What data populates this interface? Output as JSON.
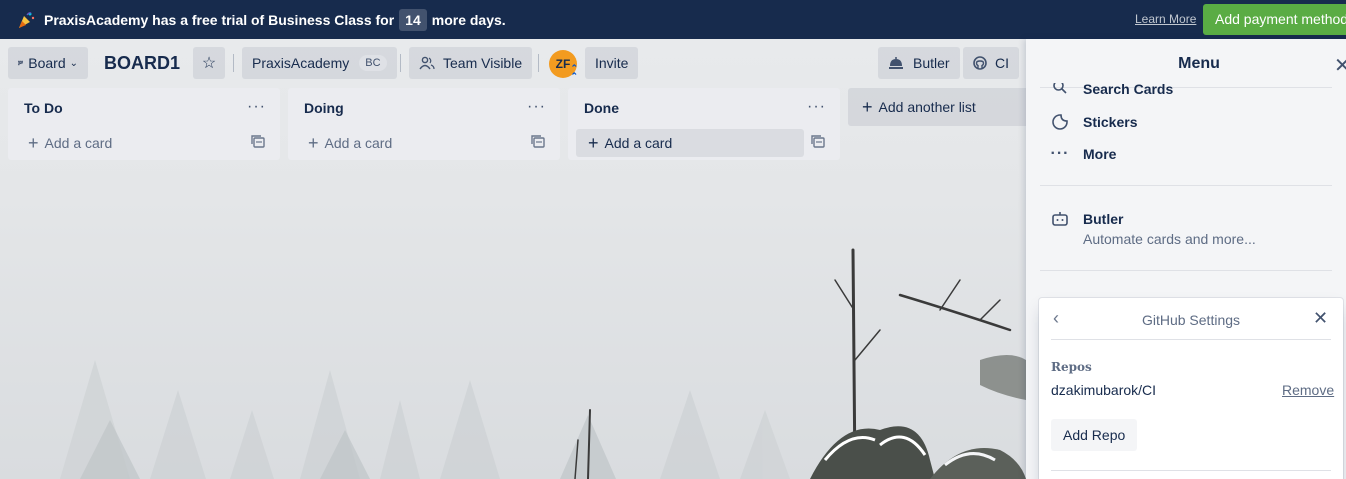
{
  "banner": {
    "message_pre": "PraxisAcademy has a free trial of Business Class for",
    "days": "14",
    "message_post": "more days.",
    "learn_more": "Learn More",
    "add_payment": "Add payment method"
  },
  "header": {
    "board_switch": "Board",
    "board_title": "BOARD1",
    "team_name": "PraxisAcademy",
    "team_badge": "BC",
    "visibility": "Team Visible",
    "avatar_initials": "ZF",
    "invite": "Invite",
    "butler": "Butler",
    "ci": "CI"
  },
  "lists": [
    {
      "name": "To Do",
      "add_label": "Add a card"
    },
    {
      "name": "Doing",
      "add_label": "Add a card"
    },
    {
      "name": "Done",
      "add_label": "Add a card"
    }
  ],
  "add_list_label": "Add another list",
  "menu": {
    "title": "Menu",
    "items": [
      {
        "label": "Search Cards",
        "icon": "search-icon"
      },
      {
        "label": "Stickers",
        "icon": "sticker-icon"
      },
      {
        "label": "More",
        "icon": "more-icon"
      }
    ],
    "butler": {
      "label": "Butler",
      "subtitle": "Automate cards and more..."
    }
  },
  "github_popover": {
    "title": "GitHub Settings",
    "repos_heading": "Repos",
    "repo_name": "dzakimubarok/CI",
    "remove_label": "Remove",
    "add_repo_label": "Add Repo"
  },
  "colors": {
    "banner_bg": "#172b4d",
    "pay_button": "#5aac44",
    "avatar": "#f29b20"
  }
}
